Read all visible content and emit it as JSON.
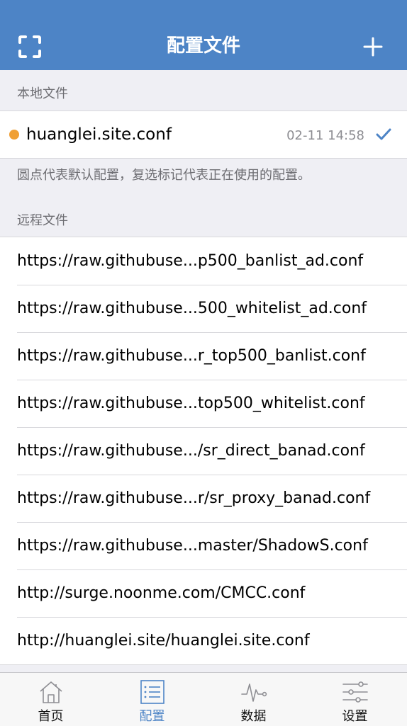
{
  "navbar": {
    "title": "配置文件",
    "left_icon": "scan-icon",
    "right_icon": "plus-icon"
  },
  "local": {
    "header": "本地文件",
    "file": {
      "name": "huanglei.site.conf",
      "time": "02-11 14:58",
      "default_dot_color": "#f0a035",
      "checked": true
    },
    "footnote": "圆点代表默认配置，复选标记代表正在使用的配置。"
  },
  "remote": {
    "header": "远程文件",
    "files": [
      "https://raw.githubuse...p500_banlist_ad.conf",
      "https://raw.githubuse...500_whitelist_ad.conf",
      "https://raw.githubuse...r_top500_banlist.conf",
      "https://raw.githubuse...top500_whitelist.conf",
      "https://raw.githubuse.../sr_direct_banad.conf",
      "https://raw.githubuse...r/sr_proxy_banad.conf",
      "https://raw.githubuse...master/ShadowS.conf",
      "http://surge.noonme.com/CMCC.conf",
      "http://huanglei.site/huanglei.site.conf"
    ]
  },
  "tabbar": {
    "tabs": [
      {
        "label": "首页",
        "icon": "home-icon",
        "active": false
      },
      {
        "label": "配置",
        "icon": "list-icon",
        "active": true
      },
      {
        "label": "数据",
        "icon": "pulse-icon",
        "active": false
      },
      {
        "label": "设置",
        "icon": "sliders-icon",
        "active": false
      }
    ]
  },
  "colors": {
    "accent": "#4d84c6",
    "dot": "#f0a035",
    "background": "#efeff4"
  }
}
